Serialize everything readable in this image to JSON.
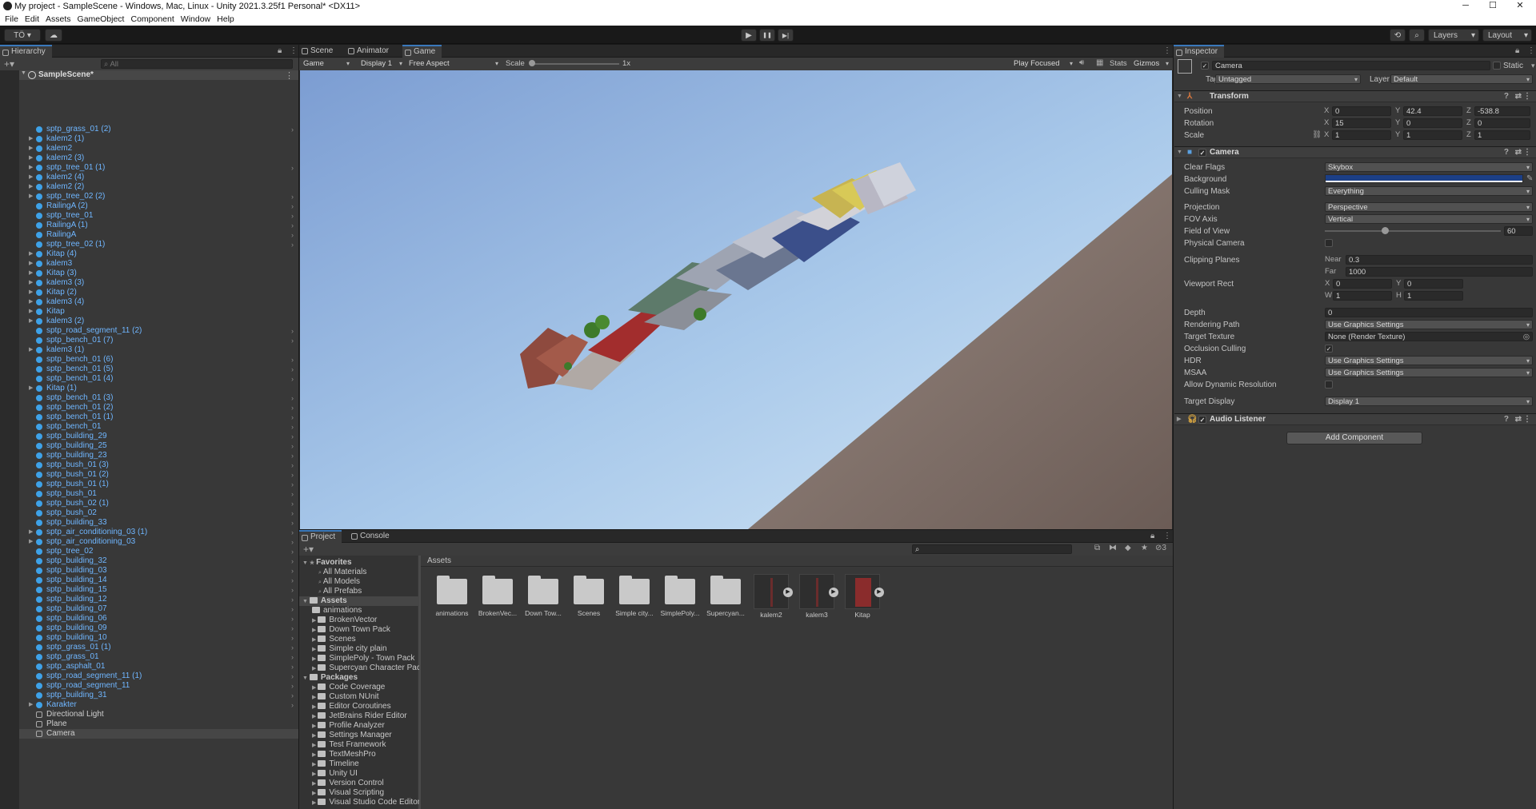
{
  "titlebar": {
    "title": "My project - SampleScene - Windows, Mac, Linux - Unity 2021.3.25f1 Personal* <DX11>",
    "min": "─",
    "max": "☐",
    "close": "✕"
  },
  "menu": [
    "File",
    "Edit",
    "Assets",
    "GameObject",
    "Component",
    "Window",
    "Help"
  ],
  "toolbar": {
    "account": "TÖ ▾",
    "layers": "Layers",
    "layout": "Layout",
    "play": "▶",
    "pause": "❚❚",
    "step": "▶|"
  },
  "hierarchy": {
    "tab": "Hierarchy",
    "search_placeholder": "All",
    "scene": "SampleScene*",
    "items": [
      {
        "name": "sptp_grass_01 (2)",
        "prefab": true,
        "exp": false,
        "chev": true
      },
      {
        "name": "kalem2 (1)",
        "prefab": true,
        "exp": true,
        "chev": false
      },
      {
        "name": "kalem2",
        "prefab": true,
        "exp": true,
        "chev": false
      },
      {
        "name": "kalem2 (3)",
        "prefab": true,
        "exp": true,
        "chev": false
      },
      {
        "name": "sptp_tree_01 (1)",
        "prefab": true,
        "exp": true,
        "chev": true
      },
      {
        "name": "kalem2 (4)",
        "prefab": true,
        "exp": true,
        "chev": false
      },
      {
        "name": "kalem2 (2)",
        "prefab": true,
        "exp": true,
        "chev": false
      },
      {
        "name": "sptp_tree_02 (2)",
        "prefab": true,
        "exp": true,
        "chev": true
      },
      {
        "name": "RailingA (2)",
        "prefab": true,
        "exp": false,
        "chev": true
      },
      {
        "name": "sptp_tree_01",
        "prefab": true,
        "exp": false,
        "chev": true
      },
      {
        "name": "RailingA (1)",
        "prefab": true,
        "exp": false,
        "chev": true
      },
      {
        "name": "RailingA",
        "prefab": true,
        "exp": false,
        "chev": true
      },
      {
        "name": "sptp_tree_02 (1)",
        "prefab": true,
        "exp": false,
        "chev": true
      },
      {
        "name": "Kitap (4)",
        "prefab": true,
        "exp": true,
        "chev": false
      },
      {
        "name": "kalem3",
        "prefab": true,
        "exp": true,
        "chev": false
      },
      {
        "name": "Kitap (3)",
        "prefab": true,
        "exp": true,
        "chev": false
      },
      {
        "name": "kalem3 (3)",
        "prefab": true,
        "exp": true,
        "chev": false
      },
      {
        "name": "Kitap (2)",
        "prefab": true,
        "exp": true,
        "chev": false
      },
      {
        "name": "kalem3 (4)",
        "prefab": true,
        "exp": true,
        "chev": false
      },
      {
        "name": "Kitap",
        "prefab": true,
        "exp": true,
        "chev": false
      },
      {
        "name": "kalem3 (2)",
        "prefab": true,
        "exp": true,
        "chev": false
      },
      {
        "name": "sptp_road_segment_11 (2)",
        "prefab": true,
        "exp": false,
        "chev": true
      },
      {
        "name": "sptp_bench_01 (7)",
        "prefab": true,
        "exp": false,
        "chev": true
      },
      {
        "name": "kalem3 (1)",
        "prefab": true,
        "exp": true,
        "chev": false
      },
      {
        "name": "sptp_bench_01 (6)",
        "prefab": true,
        "exp": false,
        "chev": true
      },
      {
        "name": "sptp_bench_01 (5)",
        "prefab": true,
        "exp": false,
        "chev": true
      },
      {
        "name": "sptp_bench_01 (4)",
        "prefab": true,
        "exp": false,
        "chev": true
      },
      {
        "name": "Kitap (1)",
        "prefab": true,
        "exp": true,
        "chev": false
      },
      {
        "name": "sptp_bench_01 (3)",
        "prefab": true,
        "exp": false,
        "chev": true
      },
      {
        "name": "sptp_bench_01 (2)",
        "prefab": true,
        "exp": false,
        "chev": true
      },
      {
        "name": "sptp_bench_01 (1)",
        "prefab": true,
        "exp": false,
        "chev": true
      },
      {
        "name": "sptp_bench_01",
        "prefab": true,
        "exp": false,
        "chev": true
      },
      {
        "name": "sptp_building_29",
        "prefab": true,
        "exp": false,
        "chev": true
      },
      {
        "name": "sptp_building_25",
        "prefab": true,
        "exp": false,
        "chev": true
      },
      {
        "name": "sptp_building_23",
        "prefab": true,
        "exp": false,
        "chev": true
      },
      {
        "name": "sptp_bush_01 (3)",
        "prefab": true,
        "exp": false,
        "chev": true
      },
      {
        "name": "sptp_bush_01 (2)",
        "prefab": true,
        "exp": false,
        "chev": true
      },
      {
        "name": "sptp_bush_01 (1)",
        "prefab": true,
        "exp": false,
        "chev": true
      },
      {
        "name": "sptp_bush_01",
        "prefab": true,
        "exp": false,
        "chev": true
      },
      {
        "name": "sptp_bush_02 (1)",
        "prefab": true,
        "exp": false,
        "chev": true
      },
      {
        "name": "sptp_bush_02",
        "prefab": true,
        "exp": false,
        "chev": true
      },
      {
        "name": "sptp_building_33",
        "prefab": true,
        "exp": false,
        "chev": true
      },
      {
        "name": "sptp_air_conditioning_03 (1)",
        "prefab": true,
        "exp": true,
        "chev": true
      },
      {
        "name": "sptp_air_conditioning_03",
        "prefab": true,
        "exp": true,
        "chev": true
      },
      {
        "name": "sptp_tree_02",
        "prefab": true,
        "exp": false,
        "chev": true
      },
      {
        "name": "sptp_building_32",
        "prefab": true,
        "exp": false,
        "chev": true
      },
      {
        "name": "sptp_building_03",
        "prefab": true,
        "exp": false,
        "chev": true
      },
      {
        "name": "sptp_building_14",
        "prefab": true,
        "exp": false,
        "chev": true
      },
      {
        "name": "sptp_building_15",
        "prefab": true,
        "exp": false,
        "chev": true
      },
      {
        "name": "sptp_building_12",
        "prefab": true,
        "exp": false,
        "chev": true
      },
      {
        "name": "sptp_building_07",
        "prefab": true,
        "exp": false,
        "chev": true
      },
      {
        "name": "sptp_building_06",
        "prefab": true,
        "exp": false,
        "chev": true
      },
      {
        "name": "sptp_building_09",
        "prefab": true,
        "exp": false,
        "chev": true
      },
      {
        "name": "sptp_building_10",
        "prefab": true,
        "exp": false,
        "chev": true
      },
      {
        "name": "sptp_grass_01 (1)",
        "prefab": true,
        "exp": false,
        "chev": true
      },
      {
        "name": "sptp_grass_01",
        "prefab": true,
        "exp": false,
        "chev": true
      },
      {
        "name": "sptp_asphalt_01",
        "prefab": true,
        "exp": false,
        "chev": true
      },
      {
        "name": "sptp_road_segment_11 (1)",
        "prefab": true,
        "exp": false,
        "chev": true
      },
      {
        "name": "sptp_road_segment_11",
        "prefab": true,
        "exp": false,
        "chev": true
      },
      {
        "name": "sptp_building_31",
        "prefab": true,
        "exp": false,
        "chev": true
      },
      {
        "name": "Karakter",
        "prefab": true,
        "exp": true,
        "chev": true
      },
      {
        "name": "Directional Light",
        "prefab": false,
        "exp": false,
        "chev": false
      },
      {
        "name": "Plane",
        "prefab": false,
        "exp": false,
        "chev": false
      },
      {
        "name": "Camera",
        "prefab": false,
        "exp": false,
        "chev": false,
        "selected": true
      }
    ]
  },
  "scene_tabs": [
    "Scene",
    "Animator",
    "Game"
  ],
  "game_bar": {
    "view": "Game",
    "display": "Display 1",
    "aspect": "Free Aspect",
    "scale_label": "Scale",
    "scale_value": "1x",
    "play_focused": "Play Focused",
    "stats": "Stats",
    "gizmos": "Gizmos"
  },
  "inspector": {
    "tab": "Inspector",
    "object_name": "Camera",
    "static": "Static",
    "tag_label": "Tag",
    "tag": "Untagged",
    "layer_label": "Layer",
    "layer": "Default",
    "transform": {
      "title": "Transform",
      "position_label": "Position",
      "rotation_label": "Rotation",
      "scale_label": "Scale",
      "position": {
        "x": "0",
        "y": "42.4",
        "z": "-538.8"
      },
      "rotation": {
        "x": "15",
        "y": "0",
        "z": "0"
      },
      "scale": {
        "x": "1",
        "y": "1",
        "z": "1"
      }
    },
    "camera": {
      "title": "Camera",
      "clear_flags_label": "Clear Flags",
      "clear_flags": "Skybox",
      "background_label": "Background",
      "background_color": "#1c3f86",
      "culling_mask_label": "Culling Mask",
      "culling_mask": "Everything",
      "projection_label": "Projection",
      "projection": "Perspective",
      "fov_axis_label": "FOV Axis",
      "fov_axis": "Vertical",
      "fov_label": "Field of View",
      "fov": "60",
      "fov_slider": 0.34,
      "physical_camera_label": "Physical Camera",
      "clipping_label": "Clipping Planes",
      "near_label": "Near",
      "near": "0.3",
      "far_label": "Far",
      "far": "1000",
      "viewport_label": "Viewport Rect",
      "vp_x": "0",
      "vp_y": "0",
      "vp_w": "1",
      "vp_h": "1",
      "depth_label": "Depth",
      "depth": "0",
      "rendering_path_label": "Rendering Path",
      "rendering_path": "Use Graphics Settings",
      "target_texture_label": "Target Texture",
      "target_texture": "None (Render Texture)",
      "occlusion_label": "Occlusion Culling",
      "hdr_label": "HDR",
      "hdr": "Use Graphics Settings",
      "msaa_label": "MSAA",
      "msaa": "Use Graphics Settings",
      "dynres_label": "Allow Dynamic Resolution",
      "target_display_label": "Target Display",
      "target_display": "Display 1"
    },
    "audio": {
      "title": "Audio Listener"
    },
    "add_component": "Add Component"
  },
  "project": {
    "tabs": [
      "Project",
      "Console"
    ],
    "favorites": "Favorites",
    "fav_items": [
      "All Materials",
      "All Models",
      "All Prefabs"
    ],
    "assets_label": "Assets",
    "asset_folders": [
      "animations",
      "BrokenVector",
      "Down Town Pack",
      "Scenes",
      "Simple city plain",
      "SimplePoly - Town Pack",
      "Supercyan Character Pac"
    ],
    "packages_label": "Packages",
    "packages": [
      "Code Coverage",
      "Custom NUnit",
      "Editor Coroutines",
      "JetBrains Rider Editor",
      "Profile Analyzer",
      "Settings Manager",
      "Test Framework",
      "TextMeshPro",
      "Timeline",
      "Unity UI",
      "Version Control",
      "Visual Scripting",
      "Visual Studio Code Editor"
    ],
    "breadcrumb": "Assets",
    "hidden_count": "3",
    "grid": [
      "animations",
      "BrokenVec...",
      "Down Tow...",
      "Scenes",
      "Simple city...",
      "SimplePoly...",
      "Supercyan...",
      "kalem2",
      "kalem3",
      "Kitap"
    ]
  }
}
